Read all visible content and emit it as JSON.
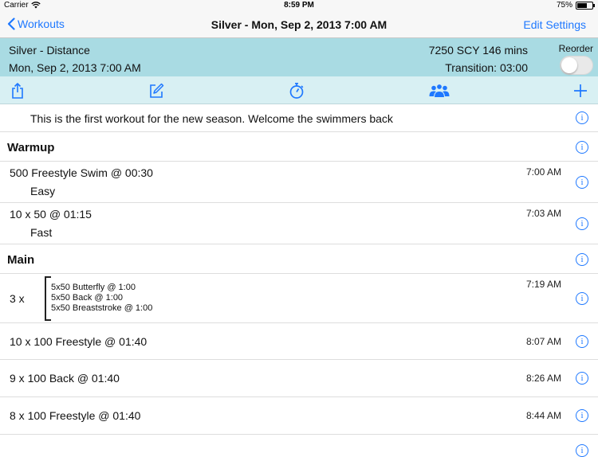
{
  "status_bar": {
    "carrier": "Carrier",
    "time": "8:59 PM",
    "battery": "75%",
    "battery_level": 0.75
  },
  "nav": {
    "back_label": "Workouts",
    "title": "Silver - Mon, Sep 2, 2013 7:00 AM",
    "right_label": "Edit Settings"
  },
  "summary": {
    "name": "Silver - Distance",
    "date": "Mon, Sep 2, 2013 7:00 AM",
    "stats": "7250 SCY 146 mins",
    "transition": "Transition: 03:00",
    "reorder_label": "Reorder",
    "reorder_on": false
  },
  "toolbar": {
    "icons": [
      "share-icon",
      "edit-icon",
      "stopwatch-icon",
      "group-icon",
      "plus-icon"
    ]
  },
  "colors": {
    "accent": "#1e78ff",
    "summary_bg": "#a9dbe3",
    "toolbar_bg": "#d8f0f3"
  },
  "list": {
    "note": "This is the first workout for the new season.  Welcome the swimmers back",
    "warmup_header": "Warmup",
    "warmup": [
      {
        "title": "500 Freestyle Swim @ 00:30",
        "subtitle": "Easy",
        "time": "7:00 AM"
      },
      {
        "title": "10 x 50 @ 01:15",
        "subtitle": "Fast",
        "time": "7:03 AM"
      }
    ],
    "main_header": "Main",
    "set_group": {
      "repeat": "3 x",
      "time": "7:19 AM",
      "lines": [
        "5x50 Butterfly @ 1:00",
        "5x50 Back @ 1:00",
        "5x50 Breaststroke @ 1:00"
      ]
    },
    "main": [
      {
        "title": "10 x 100 Freestyle @ 01:40",
        "time": "8:07 AM"
      },
      {
        "title": "9 x 100 Back @ 01:40",
        "time": "8:26 AM"
      },
      {
        "title": "8 x 100 Freestyle @ 01:40",
        "time": "8:44 AM"
      }
    ]
  }
}
